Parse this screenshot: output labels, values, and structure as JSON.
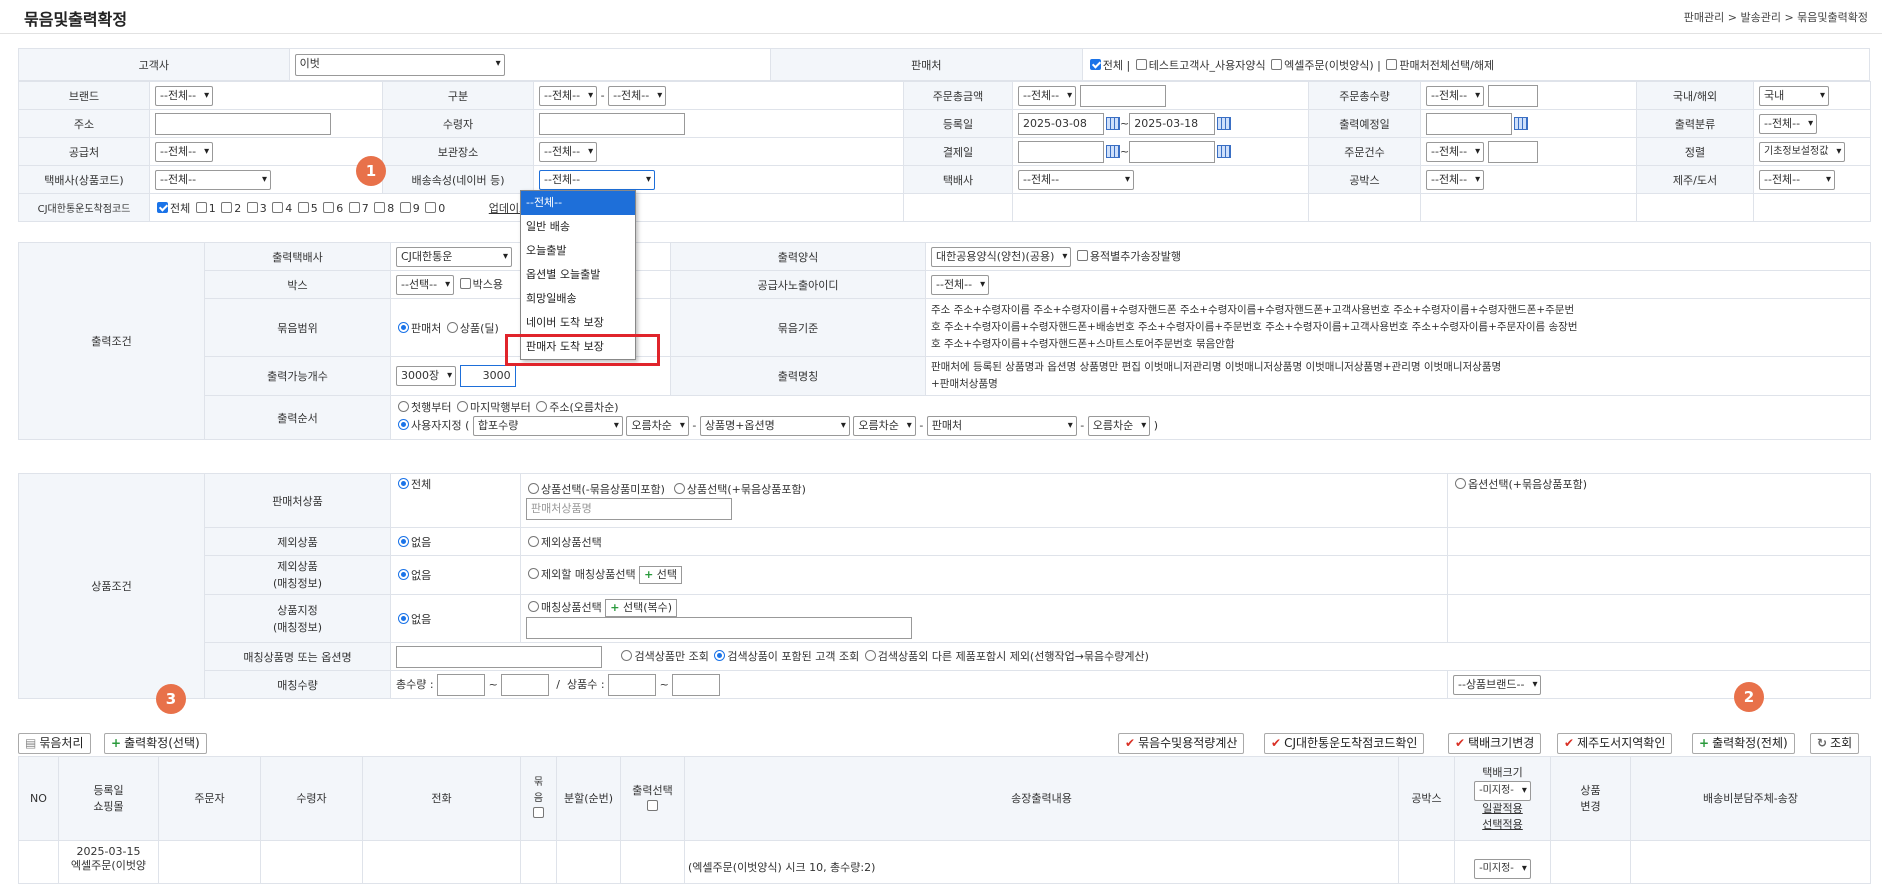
{
  "header": {
    "title": "묶음및출력확정",
    "breadcrumb": "판매관리 > 발송관리 > 묶음및출력확정"
  },
  "search": {
    "customer": {
      "label": "고객사",
      "value": "이벗"
    },
    "seller": {
      "label": "판매처",
      "all": "전체 |",
      "test": "테스트고객사_사용자양식",
      "excel": "엑셀주문(이벗양식) |",
      "toggle": "판매처전체선택/해제"
    },
    "brand": {
      "label": "브랜드",
      "value": "--전체--"
    },
    "category": {
      "label": "구분",
      "value1": "--전체--",
      "value2": "--전체--",
      "dash": "-"
    },
    "order_amount": {
      "label": "주문총금액",
      "value": "--전체--"
    },
    "order_qty": {
      "label": "주문총수량",
      "value": "--전체--"
    },
    "domestic": {
      "label": "국내/해외",
      "value": "국내"
    },
    "address": {
      "label": "주소"
    },
    "receiver": {
      "label": "수령자"
    },
    "reg_date": {
      "label": "등록일",
      "from": "2025-03-08",
      "to": "2025-03-18",
      "tilde": "~"
    },
    "print_due": {
      "label": "출력예정일"
    },
    "print_class": {
      "label": "출력분류",
      "value": "--전체--"
    },
    "supplier": {
      "label": "공급처",
      "value": "--전체--"
    },
    "storage": {
      "label": "보관장소",
      "value": "--전체--"
    },
    "pay_date": {
      "label": "결제일",
      "tilde": "~"
    },
    "order_count": {
      "label": "주문건수",
      "value": "--전체--"
    },
    "sort": {
      "label": "정렬",
      "value": "기초정보설정값"
    },
    "courier_code": {
      "label": "택배사(상품코드)",
      "value": "--전체--"
    },
    "delivery_attr": {
      "label": "배송속성(네이버 등)",
      "value": "--전체--"
    },
    "courier": {
      "label": "택배사",
      "value": "--전체--"
    },
    "box": {
      "label": "공박스",
      "value": "--전체--"
    },
    "jeju": {
      "label": "제주/도서",
      "value": "--전체--"
    },
    "cj_code": {
      "label": "CJ대한통운도착점코드",
      "all": "전체",
      "nums": [
        "1",
        "2",
        "3",
        "4",
        "5",
        "6",
        "7",
        "8",
        "9",
        "0"
      ],
      "update": "업데이트"
    }
  },
  "dropdown": {
    "options": [
      "--전체--",
      "일반 배송",
      "오늘출발",
      "옵션별 오늘출발",
      "희망일배송",
      "네이버 도착 보장",
      "판매자 도착 보장"
    ]
  },
  "output": {
    "section": "출력조건",
    "courier": {
      "label": "출력택배사",
      "value": "CJ대한통운"
    },
    "form": {
      "label": "출력양식",
      "value": "대한공용양식(양천)(공용)",
      "extra": "용적별추가송장발행"
    },
    "box": {
      "label": "박스",
      "value": "--선택--",
      "check": "박스용"
    },
    "supplier_id": {
      "label": "공급사노출아이디",
      "value": "--전체--"
    },
    "bundle_range": {
      "label": "묶음범위",
      "seller": "판매처",
      "product": "상품(딜)"
    },
    "bundle_basis": {
      "label": "묶음기준",
      "text1": "주소  주소+수령자이름  주소+수령자이름+수령자핸드폰  주소+수령자이름+수령자핸드폰+고객사용번호  주소+수령자이름+수령자핸드폰+주문번",
      "text2": "호  주소+수령자이름+수령자핸드폰+배송번호  주소+수령자이름+주문번호  주소+수령자이름+고객사용번호  주소+수령자이름+주문자이름  송장번",
      "text3": "호  주소+수령자이름+수령자핸드폰+스마트스토어주문번호  묶음안함"
    },
    "printable": {
      "label": "출력가능개수",
      "value": "3000장",
      "count": "3000"
    },
    "print_name": {
      "label": "출력명칭",
      "text1": "판매처에 등록된 상품명과 옵션명  상품명만 편집  이벗매니저관리명  이벗매니저상품명  이벗매니저상품명+관리명  이벗매니저상품명",
      "text2": "+판매처상품명"
    },
    "order": {
      "label": "출력순서",
      "first": "첫행부터",
      "last": "마지막행부터",
      "addr": "주소(오름차순)",
      "custom": "사용자지정 (",
      "s1": "합포수량",
      "o1": "오름차순",
      "s2": "상품명+옵션명",
      "o2": "오름차순",
      "s3": "판매처",
      "o3": "오름차순",
      "close": ")"
    }
  },
  "product": {
    "section": "상품조건",
    "seller_prod": {
      "label": "판매처상품",
      "all": "전체",
      "sel1": "상품선택(-묶음상품미포함)",
      "sel2": "상품선택(+묶음상품포함)",
      "opt": "옵션선택(+묶음상품포함)",
      "placeholder": "판매처상품명"
    },
    "excl": {
      "label": "제외상품",
      "none": "없음",
      "sel": "제외상품선택"
    },
    "excl_match": {
      "label1": "제외상품",
      "label2": "(매칭정보)",
      "none": "없음",
      "sel": "제외할 매칭상품선택",
      "btn": "선택"
    },
    "designate": {
      "label1": "상품지정",
      "label2": "(매칭정보)",
      "none": "없음",
      "sel": "매칭상품선택",
      "btn": "선택(복수)"
    },
    "match_name": {
      "label": "매칭상품명 또는 옵션명",
      "r1": "검색상품만 조회",
      "r2": "검색상품이 포함된 고객 조회",
      "r3": "검색상품외 다른 제품포함시 제외(선행작업→묶음수량계산)"
    },
    "match_qty": {
      "label": "매칭수량",
      "total": "총수량 :",
      "tilde": "~",
      "slash": "/",
      "prod": "상품수 :",
      "brand": "--상품브랜드--"
    }
  },
  "badges": [
    "1",
    "2",
    "3"
  ],
  "buttons": {
    "bundle": "묶음처리",
    "confirm_sel": "출력확정(선택)",
    "calc": "묶음수및용적량계산",
    "cj": "CJ대한통운도착점코드확인",
    "box_size": "택배크기변경",
    "jeju": "제주도서지역확인",
    "confirm_all": "출력확정(전체)",
    "search": "조회"
  },
  "list": {
    "headers": {
      "no": "NO",
      "reg1": "등록일",
      "reg2": "쇼핑몰",
      "orderer": "주문자",
      "receiver": "수령자",
      "phone": "전화",
      "bundle": "묶음",
      "split": "분할(순번)",
      "print_sel": "출력선택",
      "content": "송장출력내용",
      "box": "공박스",
      "size1": "택배크기",
      "size_sel": "-미지정-",
      "size2": "일괄적용",
      "size3": "선택적용",
      "change1": "상품",
      "change2": "변경",
      "fee": "배송비분담주체-송장"
    },
    "row": {
      "date": "2025-03-15",
      "mall": "엑셀주문(이벗양",
      "content": "(엑셀주문(이벗양식) 시크 10, 총수량:2)",
      "size": "-미지정-"
    }
  }
}
